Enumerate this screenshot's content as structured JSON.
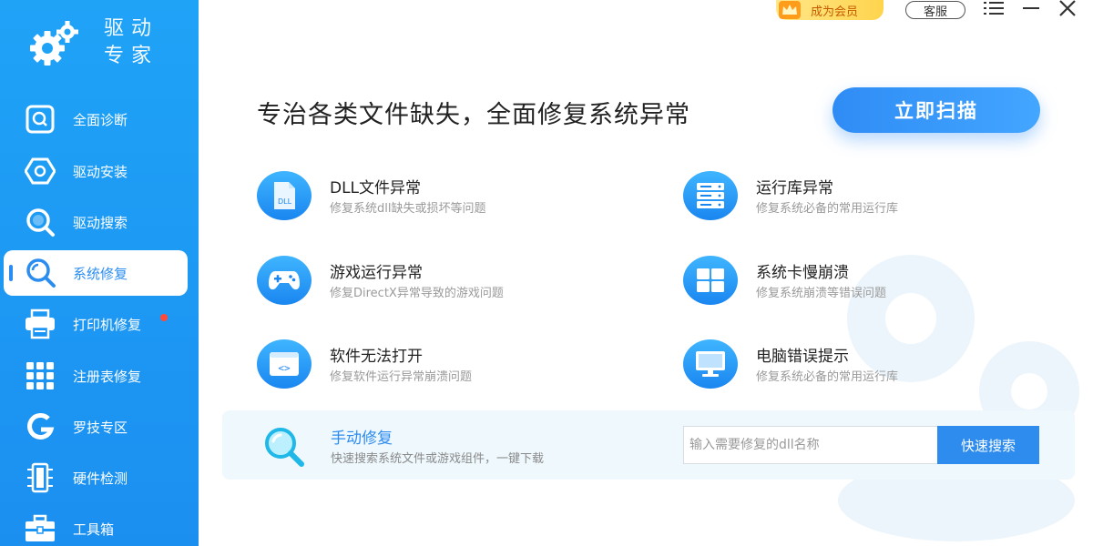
{
  "brand": {
    "line1": "驱动",
    "line2": "专家"
  },
  "sidebar": {
    "items": [
      {
        "label": "全面诊断",
        "icon": "search-square-icon",
        "active": false
      },
      {
        "label": "驱动安装",
        "icon": "hexagon-install-icon",
        "active": false
      },
      {
        "label": "驱动搜索",
        "icon": "magnifier-icon",
        "active": false
      },
      {
        "label": "系统修复",
        "icon": "repair-magnifier-icon",
        "active": true
      },
      {
        "label": "打印机修复",
        "icon": "printer-icon",
        "active": false,
        "badge": "red-dot"
      },
      {
        "label": "注册表修复",
        "icon": "grid-icon",
        "active": false
      },
      {
        "label": "罗技专区",
        "icon": "logitech-icon",
        "active": false
      },
      {
        "label": "硬件检测",
        "icon": "hardware-icon",
        "active": false
      },
      {
        "label": "工具箱",
        "icon": "toolbox-icon",
        "active": false
      }
    ]
  },
  "topbar": {
    "vip_label": "成为会员",
    "service_label": "客服"
  },
  "main": {
    "headline": "专治各类文件缺失，全面修复系统异常",
    "scan_button": "立即扫描",
    "features": [
      {
        "title": "DLL文件异常",
        "desc": "修复系统dll缺失或损坏等问题",
        "icon": "dll-file-icon"
      },
      {
        "title": "运行库异常",
        "desc": "修复系统必备的常用运行库",
        "icon": "server-icon"
      },
      {
        "title": "游戏运行异常",
        "desc": "修复DirectX异常导致的游戏问题",
        "icon": "gamepad-icon"
      },
      {
        "title": "系统卡慢崩溃",
        "desc": "修复系统崩溃等错误问题",
        "icon": "windows-icon"
      },
      {
        "title": "软件无法打开",
        "desc": "修复软件运行异常崩溃问题",
        "icon": "code-window-icon"
      },
      {
        "title": "电脑错误提示",
        "desc": "修复系统必备的常用运行库",
        "icon": "monitor-icon"
      }
    ],
    "manual": {
      "title": "手动修复",
      "desc": "快速搜索系统文件或游戏组件，一键下载",
      "input_placeholder": "输入需要修复的dll名称",
      "search_button": "快速搜索"
    }
  },
  "colors": {
    "accent": "#2e8cef",
    "sidebar": "#1b95f3",
    "vip": "#ffd44d",
    "badge": "#ff4a3a"
  }
}
